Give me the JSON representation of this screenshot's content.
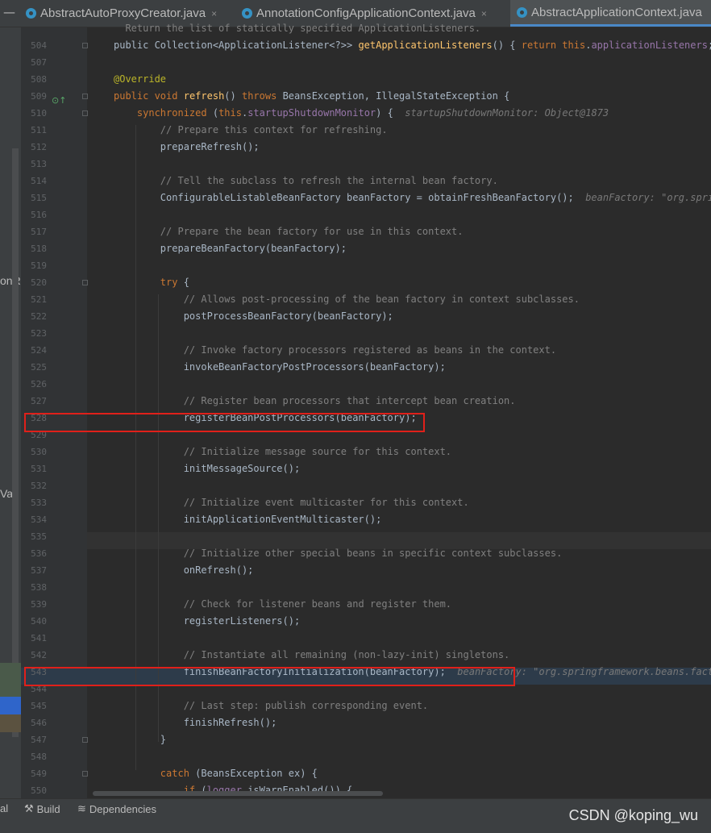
{
  "tabs": [
    {
      "label": "AbstractAutoProxyCreator.java",
      "close": "×"
    },
    {
      "label": "AnnotationConfigApplicationContext.java",
      "close": "×"
    },
    {
      "label": "AbstractApplicationContext.java"
    }
  ],
  "tabbar_dash": "—",
  "left_panel": {
    "fragment_1": "onR",
    "fragment_2": "Val"
  },
  "code_lines": [
    {
      "n": "",
      "t": "<span class=\"cm\">  Return the list of statically specified ApplicationListeners.</span>"
    },
    {
      "n": "504",
      "t": "public Collection&lt;ApplicationListener&lt;?&gt;&gt; <span class=\"fn\">getApplicationListeners</span>() { <span class=\"kw\">return this</span>.<span class=\"fld\">applicationListeners</span>; }"
    },
    {
      "n": "507",
      "t": ""
    },
    {
      "n": "508",
      "t": "<span class=\"an\">@Override</span>"
    },
    {
      "n": "509",
      "t": "<span class=\"kw\">public void</span> <span class=\"fn\">refresh</span>() <span class=\"kw\">throws</span> BeansException, IllegalStateException {"
    },
    {
      "n": "510",
      "t": "    <span class=\"kw\">synchronized</span> (<span class=\"kw\">this</span>.<span class=\"fld\">startupShutdownMonitor</span>) {  <span class=\"hint\">startupShutdownMonitor: Object@1873</span>"
    },
    {
      "n": "511",
      "t": "        <span class=\"cm\">// Prepare this context for refreshing.</span>"
    },
    {
      "n": "512",
      "t": "        prepareRefresh();"
    },
    {
      "n": "513",
      "t": ""
    },
    {
      "n": "514",
      "t": "        <span class=\"cm\">// Tell the subclass to refresh the internal bean factory.</span>"
    },
    {
      "n": "515",
      "t": "        ConfigurableListableBeanFactory beanFactory = obtainFreshBeanFactory();  <span class=\"hint\">beanFactory: \"org.springf</span>"
    },
    {
      "n": "516",
      "t": ""
    },
    {
      "n": "517",
      "t": "        <span class=\"cm\">// Prepare the bean factory for use in this context.</span>"
    },
    {
      "n": "518",
      "t": "        prepareBeanFactory(beanFactory);"
    },
    {
      "n": "519",
      "t": ""
    },
    {
      "n": "520",
      "t": "        <span class=\"kw\">try</span> {"
    },
    {
      "n": "521",
      "t": "            <span class=\"cm\">// Allows post-processing of the bean factory in context subclasses.</span>"
    },
    {
      "n": "522",
      "t": "            postProcessBeanFactory(beanFactory);"
    },
    {
      "n": "523",
      "t": ""
    },
    {
      "n": "524",
      "t": "            <span class=\"cm\">// Invoke factory processors registered as beans in the context.</span>"
    },
    {
      "n": "525",
      "t": "            invokeBeanFactoryPostProcessors(beanFactory);"
    },
    {
      "n": "526",
      "t": ""
    },
    {
      "n": "527",
      "t": "            <span class=\"cm\">// Register bean processors that intercept bean creation.</span>"
    },
    {
      "n": "528",
      "t": "            registerBeanPostProcessors(beanFactory);"
    },
    {
      "n": "529",
      "t": ""
    },
    {
      "n": "530",
      "t": "            <span class=\"cm\">// Initialize message source for this context.</span>"
    },
    {
      "n": "531",
      "t": "            initMessageSource();"
    },
    {
      "n": "532",
      "t": ""
    },
    {
      "n": "533",
      "t": "            <span class=\"cm\">// Initialize event multicaster for this context.</span>"
    },
    {
      "n": "534",
      "t": "            initApplicationEventMulticaster();"
    },
    {
      "n": "535",
      "t": ""
    },
    {
      "n": "536",
      "t": "            <span class=\"cm\">// Initialize other special beans in specific context subclasses.</span>"
    },
    {
      "n": "537",
      "t": "            onRefresh();"
    },
    {
      "n": "538",
      "t": ""
    },
    {
      "n": "539",
      "t": "            <span class=\"cm\">// Check for listener beans and register them.</span>"
    },
    {
      "n": "540",
      "t": "            registerListeners();"
    },
    {
      "n": "541",
      "t": ""
    },
    {
      "n": "542",
      "t": "            <span class=\"cm\">// Instantiate all remaining (non-lazy-init) singletons.</span>"
    },
    {
      "n": "543",
      "t": "            finishBeanFactoryInitialization(beanFactory);  <span class=\"hint\">beanFactory: \"org.springframework.beans.factory</span>"
    },
    {
      "n": "544",
      "t": ""
    },
    {
      "n": "545",
      "t": "            <span class=\"cm\">// Last step: publish corresponding event.</span>"
    },
    {
      "n": "546",
      "t": "            finishRefresh();"
    },
    {
      "n": "547",
      "t": "        }"
    },
    {
      "n": "548",
      "t": ""
    },
    {
      "n": "549",
      "t": "        <span class=\"kw\">catch</span> (BeansException ex) {"
    },
    {
      "n": "550",
      "t": "            <span class=\"kw\">if</span> (<span class=\"fld\">logger</span>.isWarnEnabled()) {"
    }
  ],
  "statusbar": {
    "left_fragment": "al",
    "build": "Build",
    "dependencies": "Dependencies",
    "watermark": "CSDN @koping_wu"
  },
  "colors": {
    "highlight_box": "#e0201a",
    "execution_line": "#2d3b4a",
    "current_caret_line": "#323232"
  }
}
